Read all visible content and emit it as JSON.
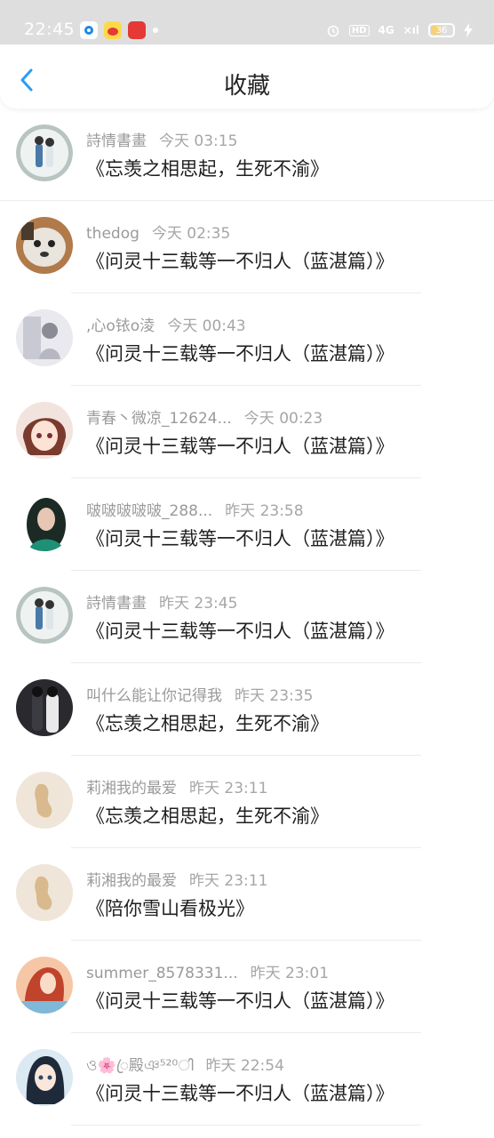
{
  "status_bar": {
    "time": "22:45",
    "battery": "36",
    "signal_label": "4G",
    "hd_label": "HD"
  },
  "header": {
    "title": "收藏"
  },
  "items": [
    {
      "name": "詩情書畫",
      "time": "今天 03:15",
      "work": "《忘羡之相思起，生死不渝》"
    },
    {
      "name": "thedog",
      "time": "今天 02:35",
      "work": "《问灵十三载等一不归人（蓝湛篇）》"
    },
    {
      "name": ",心o铱o淩",
      "time": "今天 00:43",
      "work": "《问灵十三载等一不归人（蓝湛篇）》"
    },
    {
      "name": "青春丶微凉_12624...",
      "time": "今天 00:23",
      "work": "《问灵十三载等一不归人（蓝湛篇）》"
    },
    {
      "name": "啵啵啵啵啵_288...",
      "time": "昨天 23:58",
      "work": "《问灵十三载等一不归人（蓝湛篇）》"
    },
    {
      "name": "詩情書畫",
      "time": "昨天 23:45",
      "work": "《问灵十三载等一不归人（蓝湛篇）》"
    },
    {
      "name": "叫什么能让你记得我",
      "time": "昨天 23:35",
      "work": "《忘羡之相思起，生死不渝》"
    },
    {
      "name": "莉湘我的最爱",
      "time": "昨天 23:11",
      "work": "《忘羡之相思起，生死不渝》"
    },
    {
      "name": "莉湘我的最爱",
      "time": "昨天 23:11",
      "work": "《陪你雪山看极光》"
    },
    {
      "name": "summer_8578331...",
      "time": "昨天 23:01",
      "work": "《问灵十三载等一不归人（蓝湛篇）》"
    },
    {
      "name": "ও🌸ꦿ殿ঞ⁵²⁰ി",
      "time": "昨天 22:54",
      "work": "《问灵十三载等一不归人（蓝湛篇）》"
    }
  ],
  "colors": {
    "accent": "#2a9df4",
    "status_bar_bg": "#dedede",
    "name_text": "#9a9a9a",
    "work_text": "#1f1f1f"
  }
}
